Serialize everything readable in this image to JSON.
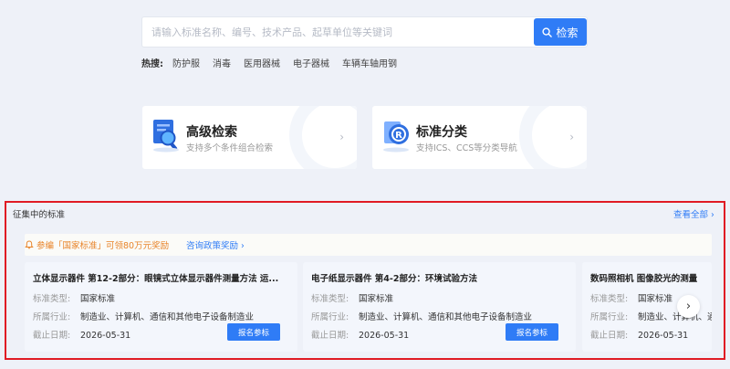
{
  "search": {
    "placeholder": "请输入标准名称、编号、技术产品、起草单位等关键词",
    "button_label": "检索"
  },
  "hot": {
    "label": "热搜:",
    "items": [
      "防护服",
      "消毒",
      "医用器械",
      "电子器械",
      "车辆车轴用钢"
    ]
  },
  "cards": {
    "advanced": {
      "title": "高级检索",
      "subtitle": "支持多个条件组合检索",
      "arrow": "›"
    },
    "category": {
      "title": "标准分类",
      "subtitle": "支持ICS、CCS等分类导航",
      "arrow": "›"
    }
  },
  "section": {
    "title": "征集中的标准",
    "view_all": "查看全部 ›",
    "banner": {
      "text": "参编「国家标准」可领80万元奖励",
      "link": "咨询政策奖励 ›"
    },
    "field_labels": {
      "type": "标准类型:",
      "industry": "所属行业:",
      "deadline": "截止日期:"
    },
    "join_label": "报名参标",
    "standards": [
      {
        "title": "立体显示器件 第12-2部分：眼镜式立体显示器件测量方法 运...",
        "type": "国家标准",
        "industry": "制造业、计算机、通信和其他电子设备制造业",
        "deadline": "2026-05-31"
      },
      {
        "title": "电子纸显示器件 第4-2部分：环境试验方法",
        "type": "国家标准",
        "industry": "制造业、计算机、通信和其他电子设备制造业",
        "deadline": "2026-05-31"
      },
      {
        "title": "数码照相机 图像胶光的测量",
        "type": "国家标准",
        "industry": "制造业、计算机、通",
        "deadline": "2026-05-31"
      }
    ],
    "next_arrow": "›"
  },
  "colors": {
    "accent": "#2f7cf6",
    "highlight_border": "#e01b24",
    "banner_text": "#e8842a"
  }
}
